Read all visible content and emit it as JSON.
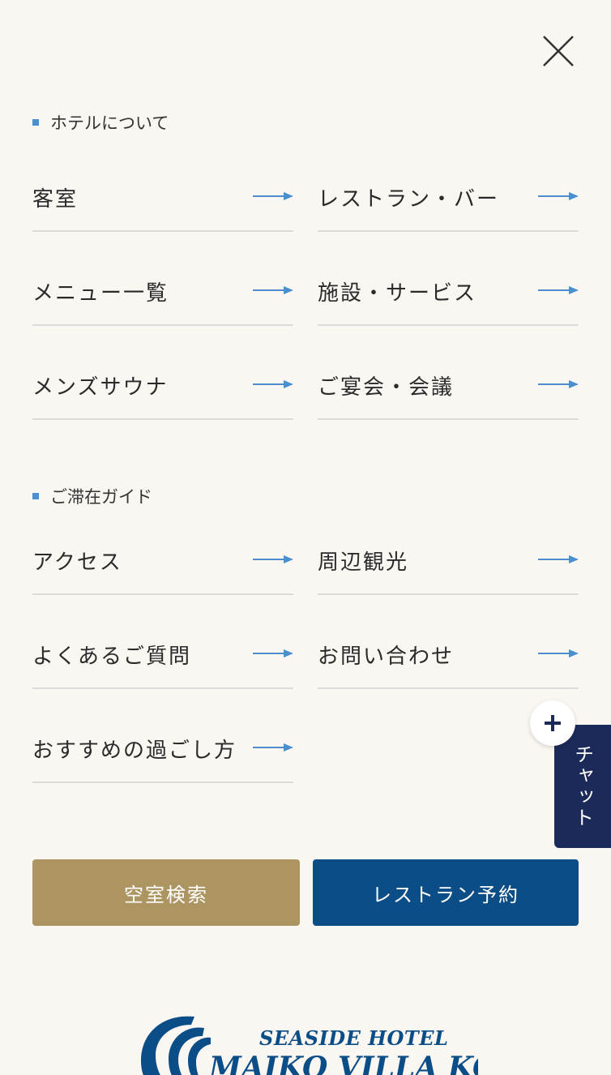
{
  "close_icon": "close-icon",
  "accent_color": "#4a8fd0",
  "sections": [
    {
      "title": "ホテルについて",
      "items": [
        {
          "label": "客室"
        },
        {
          "label": "レストラン・バー"
        },
        {
          "label": "メニュー一覧"
        },
        {
          "label": "施設・サービス"
        },
        {
          "label": "メンズサウナ"
        },
        {
          "label": "ご宴会・会議"
        }
      ]
    },
    {
      "title": "ご滞在ガイド",
      "items": [
        {
          "label": "アクセス"
        },
        {
          "label": "周辺観光"
        },
        {
          "label": "よくあるご質問"
        },
        {
          "label": "お問い合わせ"
        },
        {
          "label": "おすすめの過ごし方"
        }
      ]
    }
  ],
  "buttons": {
    "vacancy_search": "空室検索",
    "restaurant_reservation": "レストラン予約"
  },
  "button_colors": {
    "vacancy_search": "#ad9561",
    "restaurant_reservation": "#0b4e87"
  },
  "chat": {
    "label": "チャット",
    "plus_icon": "plus-icon"
  },
  "logo": {
    "line1": "SEASIDE HOTEL",
    "line2": "MAIKO VILLA KOBE"
  }
}
